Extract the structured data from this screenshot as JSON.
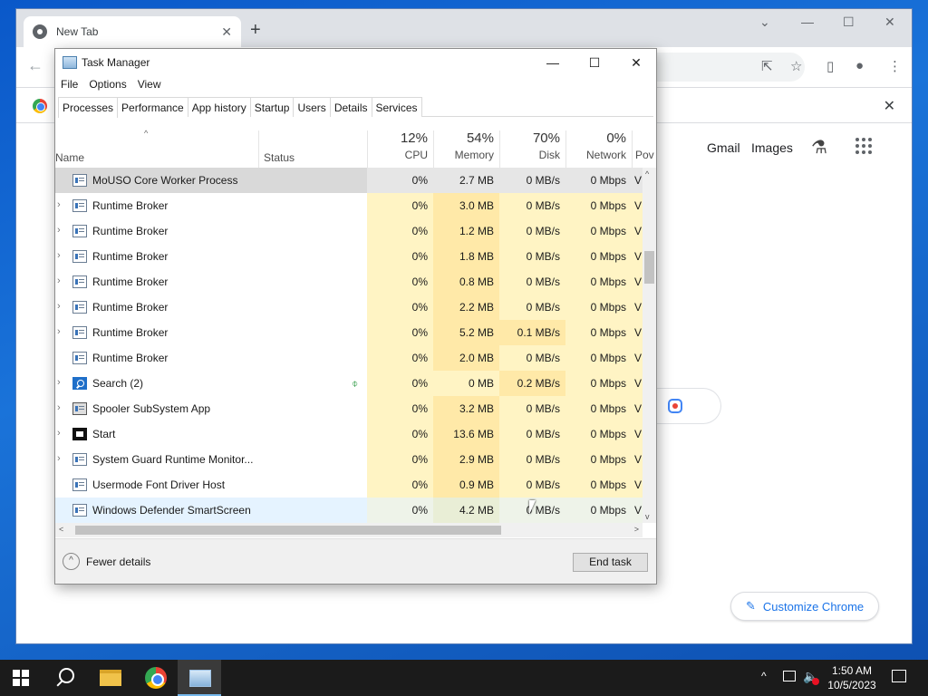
{
  "chrome": {
    "tab_title": "New Tab",
    "tab_close": "✕",
    "new_tab": "+",
    "back": "←",
    "min": "—",
    "max": "☐",
    "close": "✕",
    "dropdown": "⌄",
    "share_icon": "⇱",
    "star_icon": "☆",
    "sidepanel_icon": "▯",
    "profile_icon": "●",
    "menu_icon": "⋮",
    "bar_close": "✕",
    "gmail": "Gmail",
    "images": "Images",
    "labs_icon": "⚗",
    "customize_label": "Customize Chrome",
    "pen_icon": "✎"
  },
  "task_manager": {
    "title": "Task Manager",
    "min": "—",
    "max": "☐",
    "close": "✕",
    "menu": [
      "File",
      "Options",
      "View"
    ],
    "tabs": [
      "Processes",
      "Performance",
      "App history",
      "Startup",
      "Users",
      "Details",
      "Services"
    ],
    "active_tab": "Processes",
    "headers": {
      "sort": "^",
      "name": "Name",
      "status": "Status",
      "cpu_pct": "12%",
      "cpu": "CPU",
      "mem_pct": "54%",
      "mem": "Memory",
      "disk_pct": "70%",
      "disk": "Disk",
      "net_pct": "0%",
      "net": "Network",
      "power": "Pov"
    },
    "rows": [
      {
        "name": "MoUSO Core Worker Process",
        "cpu": "0%",
        "mem": "2.7 MB",
        "disk": "0 MB/s",
        "net": "0 Mbps",
        "pow": "V",
        "exp": ""
      },
      {
        "name": "Runtime Broker",
        "cpu": "0%",
        "mem": "3.0 MB",
        "disk": "0 MB/s",
        "net": "0 Mbps",
        "pow": "V",
        "exp": "›"
      },
      {
        "name": "Runtime Broker",
        "cpu": "0%",
        "mem": "1.2 MB",
        "disk": "0 MB/s",
        "net": "0 Mbps",
        "pow": "V",
        "exp": "›"
      },
      {
        "name": "Runtime Broker",
        "cpu": "0%",
        "mem": "1.8 MB",
        "disk": "0 MB/s",
        "net": "0 Mbps",
        "pow": "V",
        "exp": "›"
      },
      {
        "name": "Runtime Broker",
        "cpu": "0%",
        "mem": "0.8 MB",
        "disk": "0 MB/s",
        "net": "0 Mbps",
        "pow": "V",
        "exp": "›"
      },
      {
        "name": "Runtime Broker",
        "cpu": "0%",
        "mem": "2.2 MB",
        "disk": "0 MB/s",
        "net": "0 Mbps",
        "pow": "V",
        "exp": "›"
      },
      {
        "name": "Runtime Broker",
        "cpu": "0%",
        "mem": "5.2 MB",
        "disk": "0.1 MB/s",
        "net": "0 Mbps",
        "pow": "V",
        "exp": "›"
      },
      {
        "name": "Runtime Broker",
        "cpu": "0%",
        "mem": "2.0 MB",
        "disk": "0 MB/s",
        "net": "0 Mbps",
        "pow": "V",
        "exp": ""
      },
      {
        "name": "Search (2)",
        "cpu": "0%",
        "mem": "0 MB",
        "disk": "0.2 MB/s",
        "net": "0 Mbps",
        "pow": "V",
        "exp": "›"
      },
      {
        "name": "Spooler SubSystem App",
        "cpu": "0%",
        "mem": "3.2 MB",
        "disk": "0 MB/s",
        "net": "0 Mbps",
        "pow": "V",
        "exp": "›"
      },
      {
        "name": "Start",
        "cpu": "0%",
        "mem": "13.6 MB",
        "disk": "0 MB/s",
        "net": "0 Mbps",
        "pow": "V",
        "exp": "›"
      },
      {
        "name": "System Guard Runtime Monitor...",
        "cpu": "0%",
        "mem": "2.9 MB",
        "disk": "0 MB/s",
        "net": "0 Mbps",
        "pow": "V",
        "exp": "›"
      },
      {
        "name": "Usermode Font Driver Host",
        "cpu": "0%",
        "mem": "0.9 MB",
        "disk": "0 MB/s",
        "net": "0 Mbps",
        "pow": "V",
        "exp": ""
      },
      {
        "name": "Windows Defender SmartScreen",
        "cpu": "0%",
        "mem": "4.2 MB",
        "disk": "0 MB/s",
        "net": "0 Mbps",
        "pow": "V",
        "exp": ""
      }
    ],
    "leaf_icon": "⌽",
    "scroll_up": "^",
    "scroll_down": "v",
    "scroll_left": "<",
    "scroll_right": ">",
    "fewer_icon": "^",
    "fewer_details": "Fewer details",
    "end_task": "End task"
  },
  "taskbar": {
    "tray_chevron": "^",
    "volume_icon": "🔈",
    "time": "1:50 AM",
    "date": "10/5/2023"
  }
}
